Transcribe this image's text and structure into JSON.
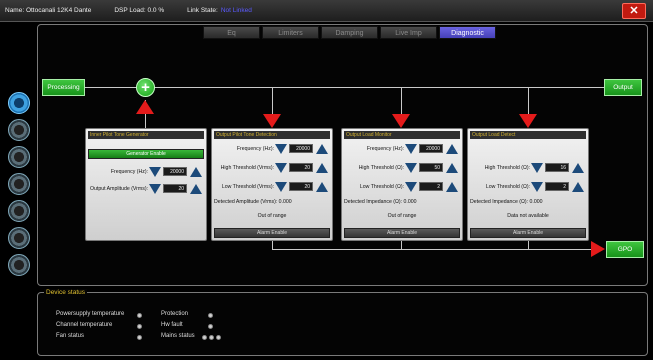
{
  "titlebar": {
    "name": "Name: Ottocanali 12K4 Dante",
    "dsp_load": "DSP Load: 0.0 %",
    "link_state_label": "Link State:",
    "link_state_value": "Not Linked",
    "close_label": "✕"
  },
  "tabs": [
    {
      "label": "Eq",
      "active": false
    },
    {
      "label": "Limiters",
      "active": false
    },
    {
      "label": "Damping",
      "active": false
    },
    {
      "label": "Live Imp",
      "active": false
    },
    {
      "label": "Diagnostic",
      "active": true
    }
  ],
  "flow": {
    "processing": "Processing",
    "output": "Output",
    "gpo": "GPO",
    "plus": "+"
  },
  "panels": {
    "generator": {
      "title": "Inner Pilot Tone Generator",
      "enable": "Generator Enable",
      "freq_label": "Frequency (Hz):",
      "freq_value": "20000",
      "amp_label": "Output Amplitude (Vrms):",
      "amp_value": "20"
    },
    "detection": {
      "title": "Output Pilot Tone Detection",
      "freq_label": "Frequency (Hz):",
      "freq_value": "20000",
      "high_label": "High Threshold (Vrms):",
      "high_value": "20",
      "low_label": "Low Threshold (Vrms):",
      "low_value": "20",
      "detected": "Detected Amplitude (Vrms): 0.000",
      "status": "Out of range",
      "alarm": "Alarm Enable"
    },
    "load_monitor": {
      "title": "Output Load Monitor",
      "freq_label": "Frequency (Hz):",
      "freq_value": "20000",
      "high_label": "High Threshold (Ω):",
      "high_value": "50",
      "low_label": "Low Threshold (Ω):",
      "low_value": "2",
      "detected": "Detected Impedance (Ω): 0.000",
      "status": "Out of range",
      "alarm": "Alarm Enable"
    },
    "load_detect": {
      "title": "Output Load Detect",
      "high_label": "High Threshold (Ω):",
      "high_value": "16",
      "low_label": "Low Threshold (Ω):",
      "low_value": "2",
      "detected": "Detected Impedance (Ω): 0.000",
      "status": "Data not available",
      "alarm": "Alarm Enable"
    }
  },
  "device_status": {
    "title": "Device status",
    "powersupply": "Powersupply temperature",
    "channel": "Channel temperature",
    "fan": "Fan status",
    "protection": "Protection",
    "hwfault": "Hw fault",
    "mains": "Mains status"
  },
  "colors": {
    "accent_red": "#e41b1b",
    "accent_green": "#1aa01a",
    "active_tab": "#5a53d8",
    "panel_title": "#d4b230"
  },
  "left_icons": [
    "channel-icon",
    "channel-icon",
    "channel-icon",
    "channel-icon",
    "channel-icon",
    "channel-icon",
    "channel-icon",
    "channel-icon"
  ]
}
